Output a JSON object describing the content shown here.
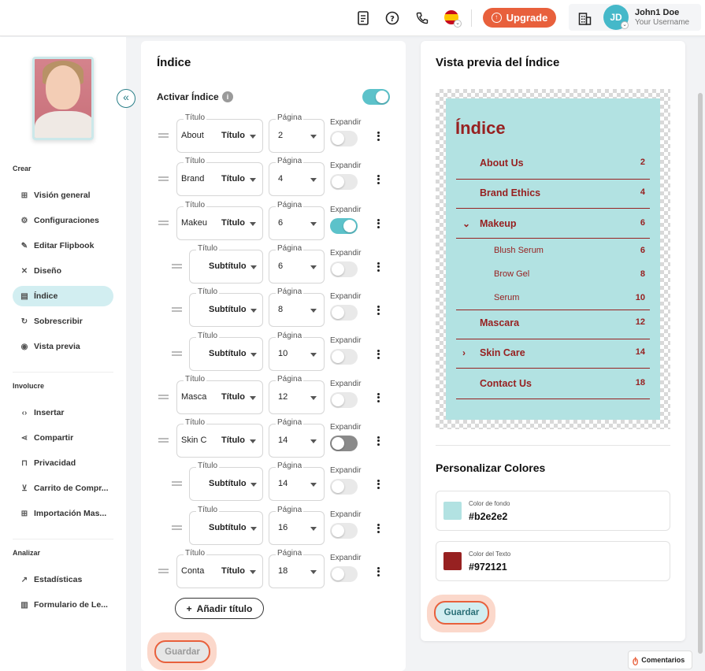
{
  "topbar": {
    "upgrade_label": "Upgrade",
    "user_initials": "JD",
    "user_name": "John1 Doe",
    "user_username": "Your Username",
    "icons": [
      "document-icon",
      "help-icon",
      "phone-icon",
      "spain-flag-icon",
      "building-icon"
    ]
  },
  "sidebar": {
    "sections": [
      {
        "label": "Crear",
        "items": [
          {
            "label": "Visión general",
            "icon": "overview-icon"
          },
          {
            "label": "Configuraciones",
            "icon": "gear-icon"
          },
          {
            "label": "Editar Flipbook",
            "icon": "pencil-icon"
          },
          {
            "label": "Diseño",
            "icon": "design-icon"
          },
          {
            "label": "Índice",
            "icon": "index-icon",
            "active": true
          },
          {
            "label": "Sobrescribir",
            "icon": "refresh-icon"
          },
          {
            "label": "Vista previa",
            "icon": "eye-icon"
          }
        ]
      },
      {
        "label": "Involucre",
        "items": [
          {
            "label": "Insertar",
            "icon": "code-icon"
          },
          {
            "label": "Compartir",
            "icon": "share-icon"
          },
          {
            "label": "Privacidad",
            "icon": "lock-icon"
          },
          {
            "label": "Carrito de Compr...",
            "icon": "cart-icon"
          },
          {
            "label": "Importación Mas...",
            "icon": "import-icon"
          }
        ]
      },
      {
        "label": "Analizar",
        "items": [
          {
            "label": "Estadísticas",
            "icon": "stats-icon"
          },
          {
            "label": "Formulario de Le...",
            "icon": "form-icon"
          }
        ]
      }
    ]
  },
  "index_panel": {
    "title": "Índice",
    "activate_label": "Activar Índice",
    "activate_on": true,
    "field_titulo": "Título",
    "field_pagina": "Página",
    "field_expandir": "Expandir",
    "rows": [
      {
        "text": "About",
        "type": "Título",
        "page": "2",
        "expand": "off",
        "sub": false
      },
      {
        "text": "Brand",
        "type": "Título",
        "page": "4",
        "expand": "off",
        "sub": false
      },
      {
        "text": "Makeu",
        "type": "Título",
        "page": "6",
        "expand": "on",
        "sub": false
      },
      {
        "text": "",
        "type": "Subtítulo",
        "page": "6",
        "expand": "off",
        "sub": true
      },
      {
        "text": "",
        "type": "Subtítulo",
        "page": "8",
        "expand": "off",
        "sub": true
      },
      {
        "text": "",
        "type": "Subtítulo",
        "page": "10",
        "expand": "off",
        "sub": true
      },
      {
        "text": "Masca",
        "type": "Título",
        "page": "12",
        "expand": "off",
        "sub": false
      },
      {
        "text": "Skin C",
        "type": "Título",
        "page": "14",
        "expand": "dark",
        "sub": false
      },
      {
        "text": "",
        "type": "Subtítulo",
        "page": "14",
        "expand": "off",
        "sub": true
      },
      {
        "text": "",
        "type": "Subtítulo",
        "page": "16",
        "expand": "off",
        "sub": true
      },
      {
        "text": "Conta",
        "type": "Título",
        "page": "18",
        "expand": "off",
        "sub": false
      }
    ],
    "add_label": "Añadir título",
    "save_label": "Guardar"
  },
  "preview_panel": {
    "title": "Vista previa del Índice",
    "heading": "Índice",
    "entries": [
      {
        "label": "About Us",
        "page": "2",
        "kind": "main"
      },
      {
        "label": "Brand Ethics",
        "page": "4",
        "kind": "main"
      },
      {
        "label": "Makeup",
        "page": "6",
        "kind": "main",
        "chevron": "v"
      },
      {
        "label": "Blush Serum",
        "page": "6",
        "kind": "sub"
      },
      {
        "label": "Brow Gel",
        "page": "8",
        "kind": "sub"
      },
      {
        "label": "Serum",
        "page": "10",
        "kind": "sub"
      },
      {
        "label": "Mascara",
        "page": "12",
        "kind": "main"
      },
      {
        "label": "Skin Care",
        "page": "14",
        "kind": "main",
        "chevron": "›"
      },
      {
        "label": "Contact Us",
        "page": "18",
        "kind": "main"
      }
    ],
    "customize_title": "Personalizar Colores",
    "bg_label": "Color de fondo",
    "bg_value": "#b2e2e2",
    "text_label": "Color del Texto",
    "text_value": "#972121",
    "save_label": "Guardar"
  },
  "comments_label": "Comentarios",
  "colors": {
    "accent": "#e8603c",
    "teal": "#5cc2ca",
    "preview_bg": "#b2e2e2",
    "preview_text": "#972121"
  }
}
